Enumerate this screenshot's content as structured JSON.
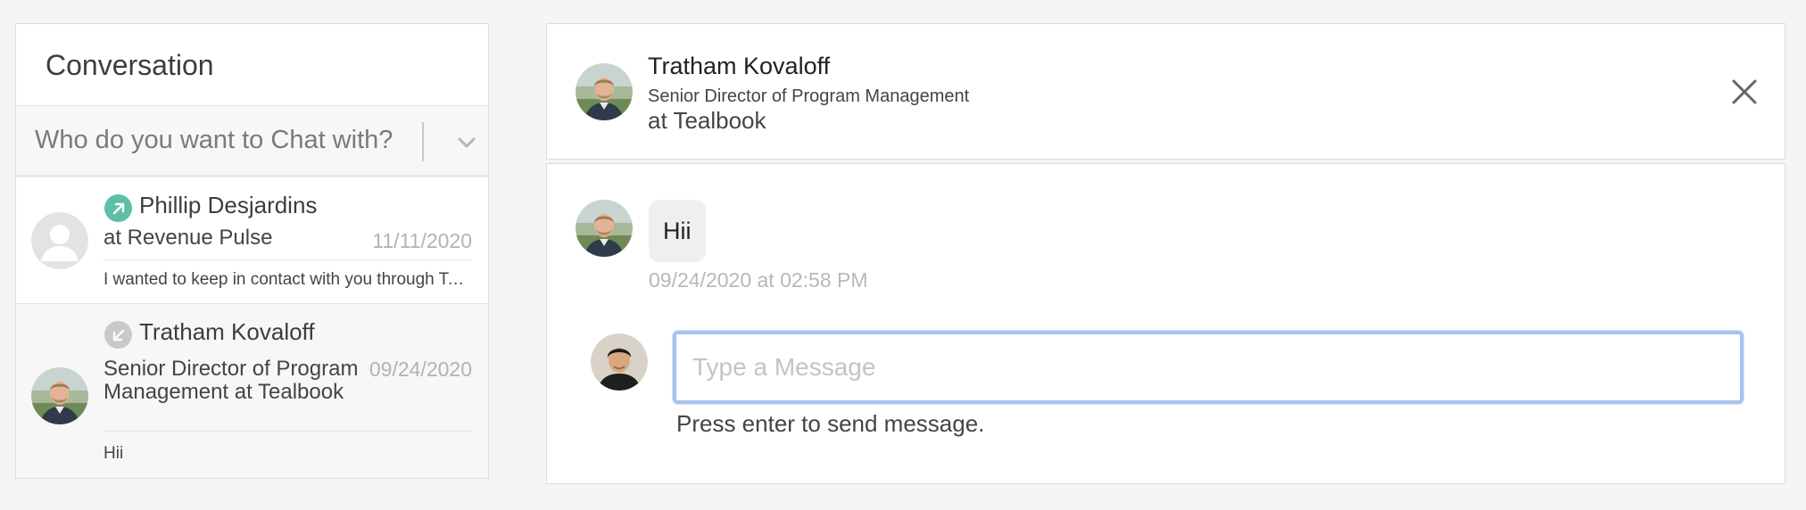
{
  "conversation_panel": {
    "title": "Conversation",
    "select": {
      "placeholder": "Who do you want to Chat with?",
      "chevron_icon": "chevron-down-icon"
    },
    "items": [
      {
        "name": "Phillip Desjardins",
        "company": "at Revenue Pulse",
        "date": "11/11/2020",
        "preview": "I wanted to keep in contact with you through Tealbook",
        "direction": "outgoing",
        "direction_icon": "arrow-up-right-icon",
        "direction_color": "#5dbfa8",
        "avatar": "default-avatar"
      },
      {
        "name": "Tratham Kovaloff",
        "company": "Senior Director of Program Management at Tealbook",
        "date": "09/24/2020",
        "preview": "Hii",
        "direction": "incoming",
        "direction_icon": "arrow-down-left-icon",
        "direction_color": "#c9c9c9",
        "avatar": "photo-avatar"
      }
    ]
  },
  "chat_header": {
    "name": "Tratham Kovaloff",
    "role": "Senior Director of Program Management",
    "company": "at Tealbook",
    "close_icon": "close-icon"
  },
  "chat": {
    "messages": [
      {
        "text": "Hii",
        "timestamp": "09/24/2020 at 02:58 PM"
      }
    ],
    "input": {
      "placeholder": "Type a Message",
      "value": ""
    },
    "hint": "Press enter to send message.",
    "focus_color": "#a9c1ef"
  }
}
